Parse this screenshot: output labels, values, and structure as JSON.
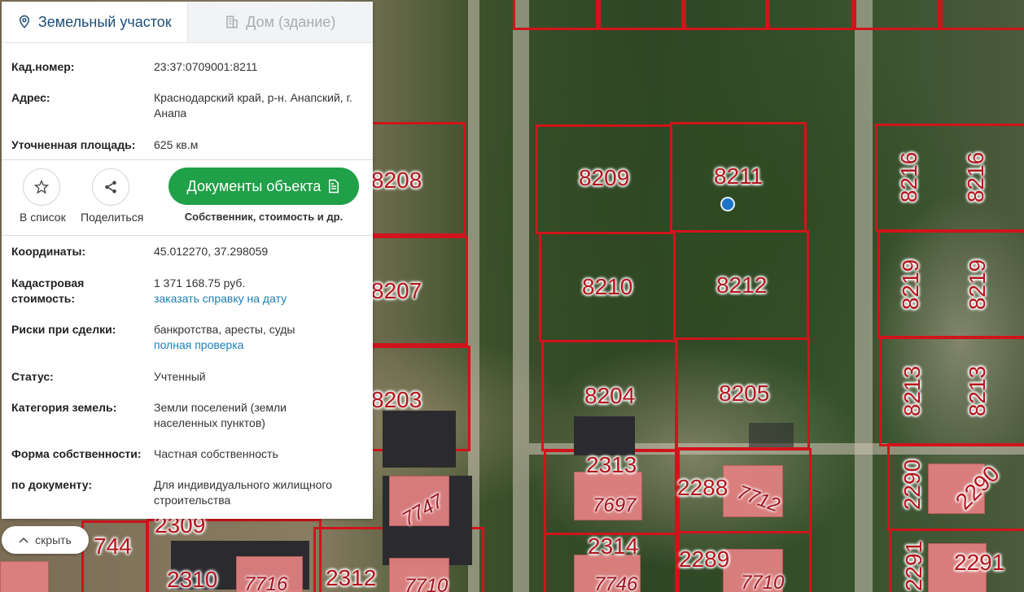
{
  "tabs": [
    {
      "label": "Земельный участок",
      "icon": "location-pin-icon",
      "active": true
    },
    {
      "label": "Дом (здание)",
      "icon": "building-icon",
      "active": false
    }
  ],
  "info": {
    "cad_label": "Кад.номер:",
    "cad_value": "23:37:0709001:8211",
    "address_label": "Адрес:",
    "address_value": "Краснодарский край, р-н. Анапский, г. Анапа",
    "area_label": "Уточненная площадь:",
    "area_value": "625 кв.м"
  },
  "actions": {
    "favorite_label": "В список",
    "share_label": "Поделиться",
    "docs_button": "Документы объекта",
    "docs_sub": "Собственник, стоимость и др."
  },
  "details": {
    "coords_label": "Координаты:",
    "coords_value": "45.012270, 37.298059",
    "cost_label": "Кадастровая стоимость:",
    "cost_value": "1 371 168.75 руб.",
    "cost_link": "заказать справку на дату",
    "risks_label": "Риски при сделки:",
    "risks_value": "банкротства, аресты, суды",
    "risks_link": "полная проверка",
    "status_label": "Статус:",
    "status_value": "Учтенный",
    "category_label": "Категория земель:",
    "category_value": "Земли поселений (земли населенных пунктов)",
    "ownership_label": "Форма собственности:",
    "ownership_value": "Частная собственность",
    "doc_label": "по документу:",
    "doc_value": "Для индивидуального жилищного строительства"
  },
  "hide_button": "скрыть",
  "map": {
    "parcels": [
      "8208",
      "8207",
      "8203",
      "8209",
      "8211",
      "8210",
      "8212",
      "8204",
      "8205",
      "8216",
      "8216",
      "8219",
      "8219",
      "8213",
      "8213",
      "2313",
      "2288",
      "2290",
      "2290",
      "2314",
      "2289",
      "2291",
      "2291",
      "2309",
      "2310",
      "2312",
      "744"
    ],
    "buildings": [
      "7747",
      "7697",
      "7712",
      "7746",
      "7710",
      "7710",
      "7716"
    ]
  },
  "colors": {
    "parcel_border": "#d0141b",
    "accent_green": "#20a048",
    "link": "#1a7fb5",
    "marker": "#1a73c8"
  }
}
